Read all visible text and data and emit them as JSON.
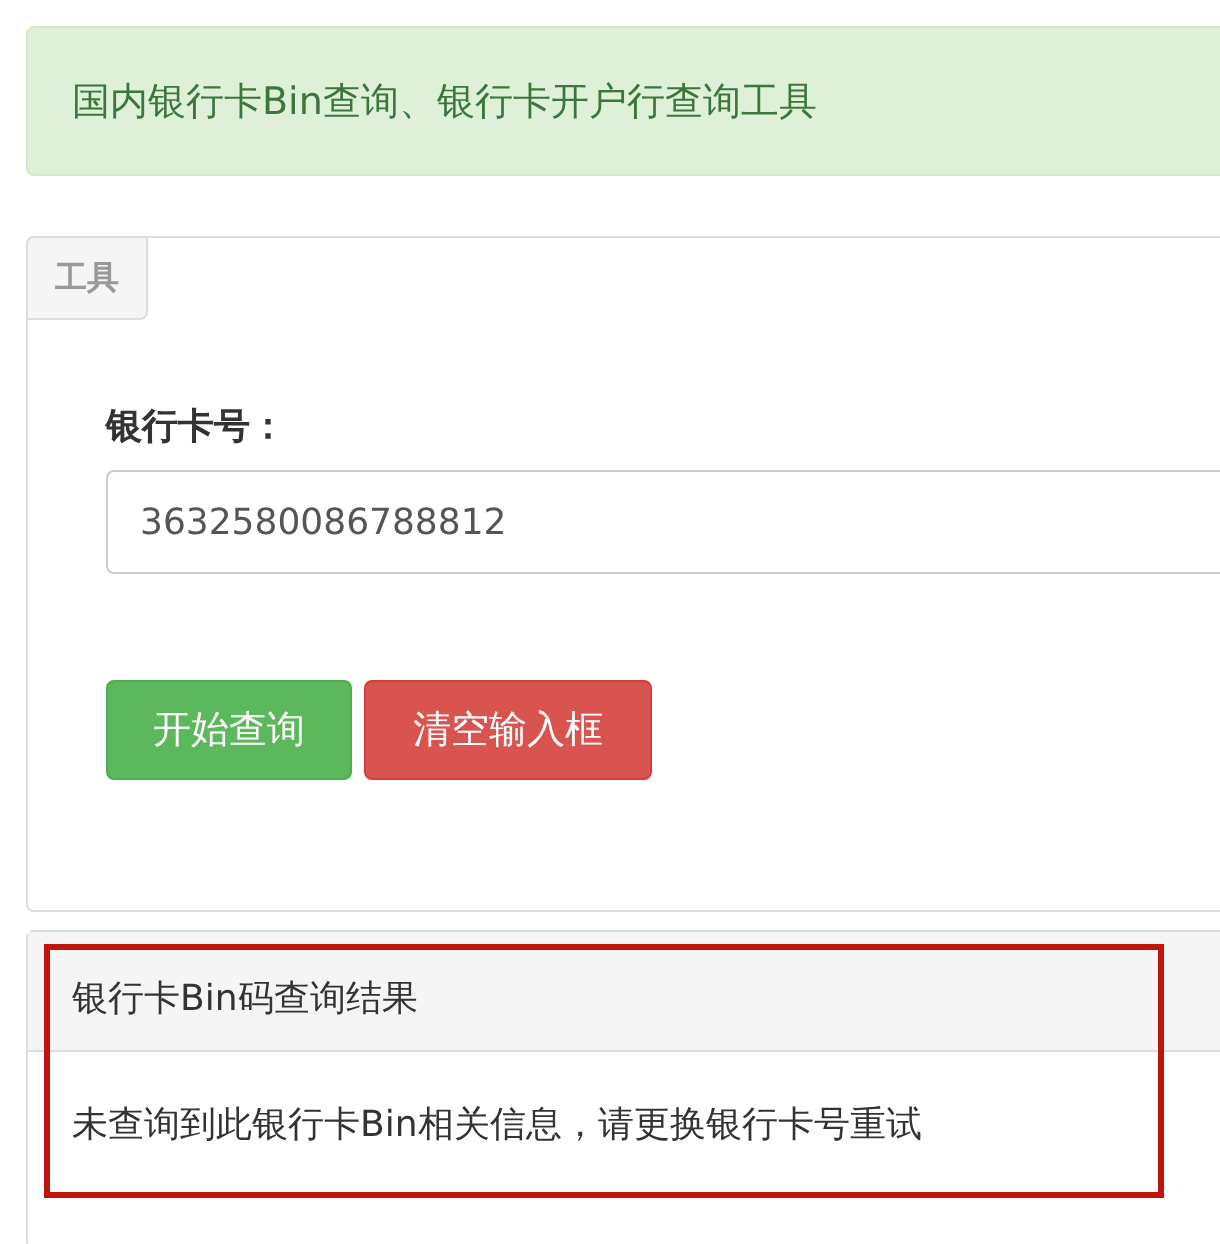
{
  "alert": {
    "text": "国内银行卡Bin查询、银行卡开户行查询工具"
  },
  "tools_panel": {
    "tab": "工具",
    "field_label": "银行卡号：",
    "card_number": {
      "value": "3632580086788812"
    },
    "buttons": [
      {
        "label": "开始查询",
        "kind": "success"
      },
      {
        "label": "清空输入框",
        "kind": "danger"
      }
    ]
  },
  "result_panel": {
    "title": "银行卡Bin码查询结果",
    "message": "未查询到此银行卡Bin相关信息，请更换银行卡号重试",
    "highlighted": true
  }
}
